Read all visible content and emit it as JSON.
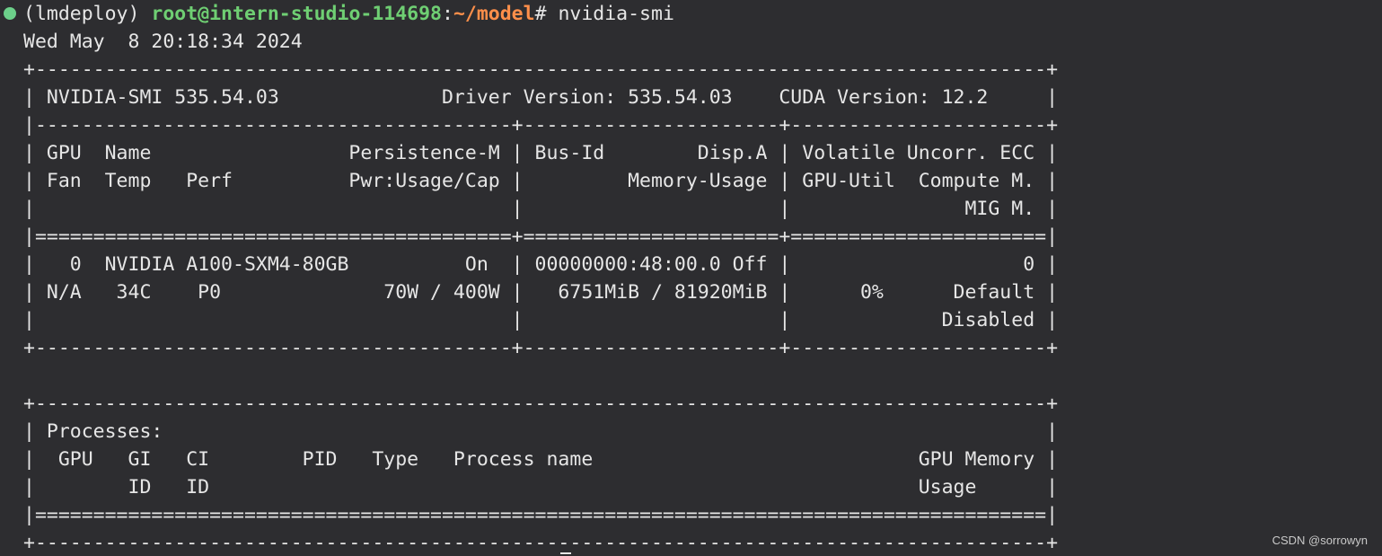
{
  "prompt": {
    "env": "(lmdeploy) ",
    "user_host": "root@intern-studio-114698",
    "colon": ":",
    "path": "~/model",
    "hash": "# ",
    "command": "nvidia-smi"
  },
  "output_lines": [
    "Wed May  8 20:18:34 2024",
    "+---------------------------------------------------------------------------------------+",
    "| NVIDIA-SMI 535.54.03              Driver Version: 535.54.03    CUDA Version: 12.2     |",
    "|-----------------------------------------+----------------------+----------------------+",
    "| GPU  Name                 Persistence-M | Bus-Id        Disp.A | Volatile Uncorr. ECC |",
    "| Fan  Temp   Perf          Pwr:Usage/Cap |         Memory-Usage | GPU-Util  Compute M. |",
    "|                                         |                      |               MIG M. |",
    "|=========================================+======================+======================|",
    "|   0  NVIDIA A100-SXM4-80GB          On  | 00000000:48:00.0 Off |                    0 |",
    "| N/A   34C    P0              70W / 400W |   6751MiB / 81920MiB |      0%      Default |",
    "|                                         |                      |             Disabled |",
    "+-----------------------------------------+----------------------+----------------------+",
    "",
    "+---------------------------------------------------------------------------------------+",
    "| Processes:                                                                            |",
    "|  GPU   GI   CI        PID   Type   Process name                            GPU Memory |",
    "|        ID   ID                                                             Usage      |",
    "|=======================================================================================|",
    "+---------------------------------------------------------------------------------------+"
  ],
  "watermark": "CSDN @sorrowyn"
}
